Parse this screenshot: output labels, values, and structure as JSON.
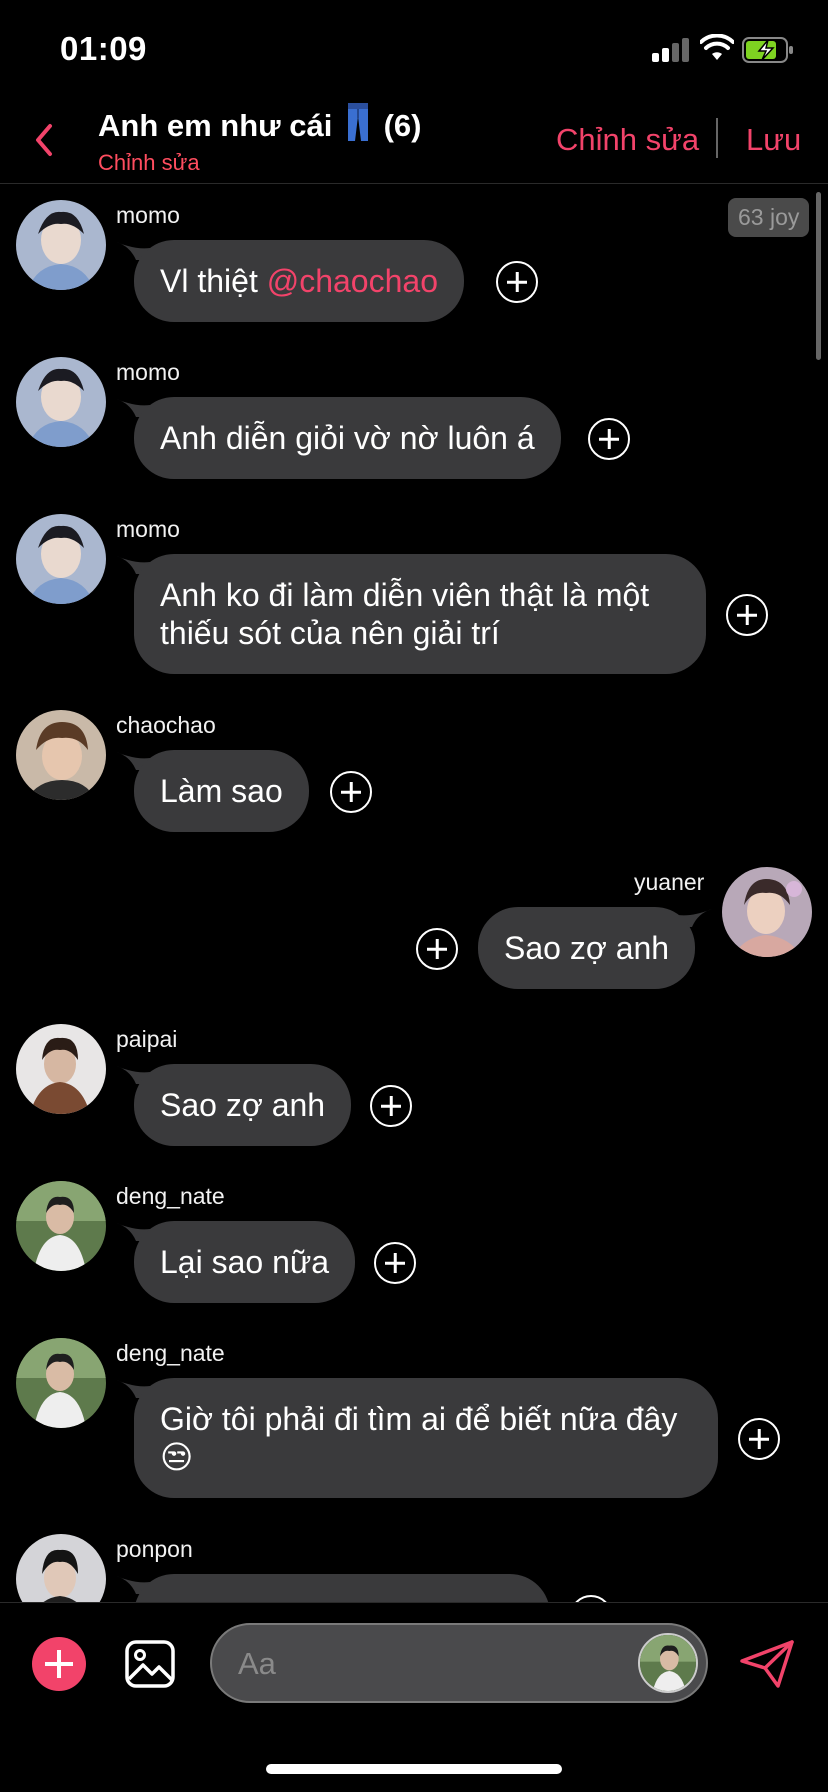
{
  "status_bar": {
    "time": "01:09",
    "battery_color": "#7ed321"
  },
  "header": {
    "title_text": "Anh em như cái",
    "title_icon": "jeans-icon",
    "member_count": "(6)",
    "subtitle": "Chỉnh sửa",
    "edit_label": "Chỉnh sửa",
    "save_label": "Lưu"
  },
  "accent_color": "#f2436a",
  "badge": {
    "text": "63 joy"
  },
  "messages": [
    {
      "sender": "momo",
      "side": "left",
      "text": "Vl thiệt ",
      "mention": "@chaochao"
    },
    {
      "sender": "momo",
      "side": "left",
      "text": "Anh diễn giỏi vờ nờ luôn á"
    },
    {
      "sender": "momo",
      "side": "left",
      "text_line1": "Anh ko đi làm diễn viên thật là một",
      "text_line2": "thiếu sót của nên giải trí"
    },
    {
      "sender": "chaochao",
      "side": "left",
      "text": "Làm sao"
    },
    {
      "sender": "yuaner",
      "side": "right",
      "text": "Sao zợ anh"
    },
    {
      "sender": "paipai",
      "side": "left",
      "text": "Sao zợ anh"
    },
    {
      "sender": "deng_nate",
      "side": "left",
      "text": "Lại sao nữa"
    },
    {
      "sender": "deng_nate",
      "side": "left",
      "text_line1": "Giờ tôi phải đi tìm ai để biết nữa đây",
      "emoji": "😒"
    },
    {
      "sender": "ponpon",
      "side": "left",
      "text": ""
    }
  ],
  "composer": {
    "placeholder": "Aa"
  }
}
